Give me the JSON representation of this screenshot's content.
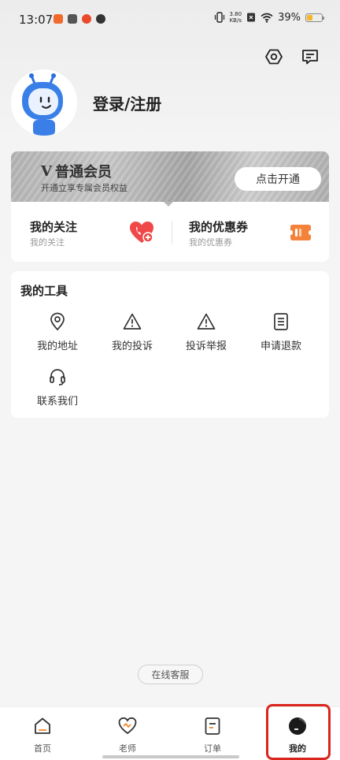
{
  "status_bar": {
    "time": "13:07",
    "net_speed_value": "3.80",
    "net_speed_unit": "KB/s",
    "battery": "39%",
    "battery_level": 0.39
  },
  "header": {
    "settings_icon": "settings-hex-icon",
    "message_icon": "message-icon"
  },
  "profile": {
    "login_label": "登录/注册",
    "avatar_icon": "robot-mascot"
  },
  "vip": {
    "badge": "V",
    "title": "普通会员",
    "subtitle": "开通立享专属会员权益",
    "button_label": "点击开通"
  },
  "shortcuts": [
    {
      "title": "我的关注",
      "subtitle": "我的关注",
      "icon": "heart-phone-icon",
      "color": "#ef4b4b"
    },
    {
      "title": "我的优惠券",
      "subtitle": "我的优惠券",
      "icon": "coupon-icon",
      "color": "#f5823a"
    }
  ],
  "tools": {
    "title": "我的工具",
    "items": [
      {
        "label": "我的地址",
        "icon": "location-icon"
      },
      {
        "label": "我的投诉",
        "icon": "warning-icon"
      },
      {
        "label": "投诉举报",
        "icon": "warning-icon"
      },
      {
        "label": "申请退款",
        "icon": "document-icon"
      },
      {
        "label": "联系我们",
        "icon": "headset-icon"
      }
    ]
  },
  "online_service": "在线客服",
  "bottom_nav": {
    "items": [
      {
        "label": "首页",
        "icon": "home-icon"
      },
      {
        "label": "老师",
        "icon": "heart-icon"
      },
      {
        "label": "订单",
        "icon": "order-icon"
      },
      {
        "label": "我的",
        "icon": "profile-avatar-icon"
      }
    ],
    "active_index": 3
  },
  "accent_color": "#d9261c"
}
